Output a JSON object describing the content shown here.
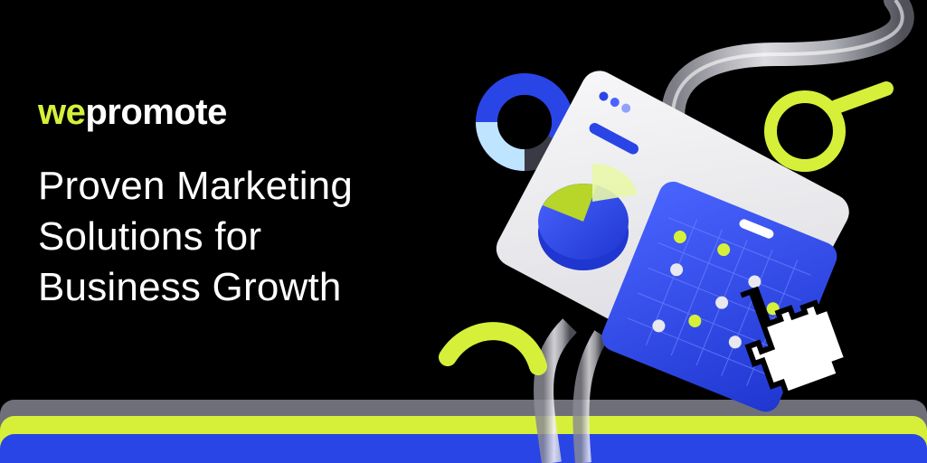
{
  "brand": {
    "prefix": "we",
    "suffix": "promote"
  },
  "headline": {
    "line1": "Proven Marketing",
    "line2": "Solutions for",
    "line3": "Business Growth"
  },
  "colors": {
    "background": "#000000",
    "accent_lime": "#d6f03a",
    "accent_blue": "#2a45e6",
    "stripe_gray": "#6f6f7a",
    "panel": "#ececee"
  },
  "icons": [
    "donut-chart-icon",
    "magnifier-icon",
    "pie-chart-icon",
    "pointer-hand-icon",
    "glass-tube-decoration"
  ]
}
